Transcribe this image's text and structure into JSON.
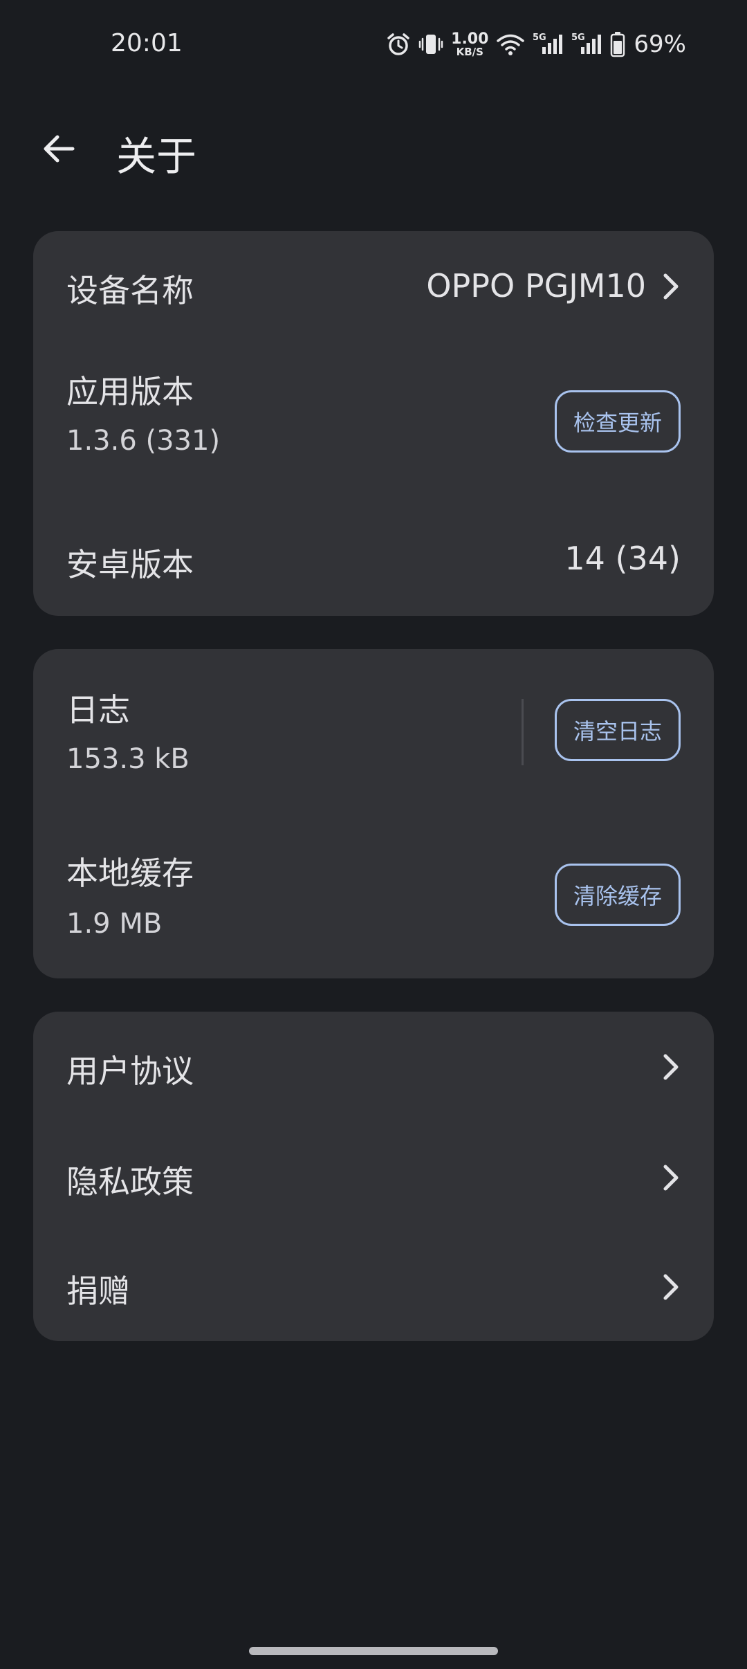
{
  "status_bar": {
    "time": "20:01",
    "net_speed_value": "1.00",
    "net_speed_unit": "KB/S",
    "signal1_label": "5G",
    "signal2_label": "5G",
    "battery": "69%",
    "icons": [
      "alarm-icon",
      "vibrate-icon",
      "wifi-icon",
      "signal-icon",
      "signal-icon",
      "battery-icon"
    ]
  },
  "header": {
    "title": "关于"
  },
  "card_device": {
    "device_name_label": "设备名称",
    "device_name_value": "OPPO PGJM10",
    "app_version_label": "应用版本",
    "app_version_value": "1.3.6 (331)",
    "check_update_button": "检查更新",
    "android_version_label": "安卓版本",
    "android_version_value": "14 (34)"
  },
  "card_storage": {
    "log_label": "日志",
    "log_size": "153.3 kB",
    "clear_log_button": "清空日志",
    "cache_label": "本地缓存",
    "cache_size": "1.9 MB",
    "clear_cache_button": "清除缓存"
  },
  "card_links": {
    "items": [
      {
        "label": "用户协议"
      },
      {
        "label": "隐私政策"
      },
      {
        "label": "捐赠"
      }
    ]
  },
  "colors": {
    "background": "#1a1c20",
    "card": "#323337",
    "accent_outline": "#a9c3ee",
    "text": "#e4e4e7"
  }
}
